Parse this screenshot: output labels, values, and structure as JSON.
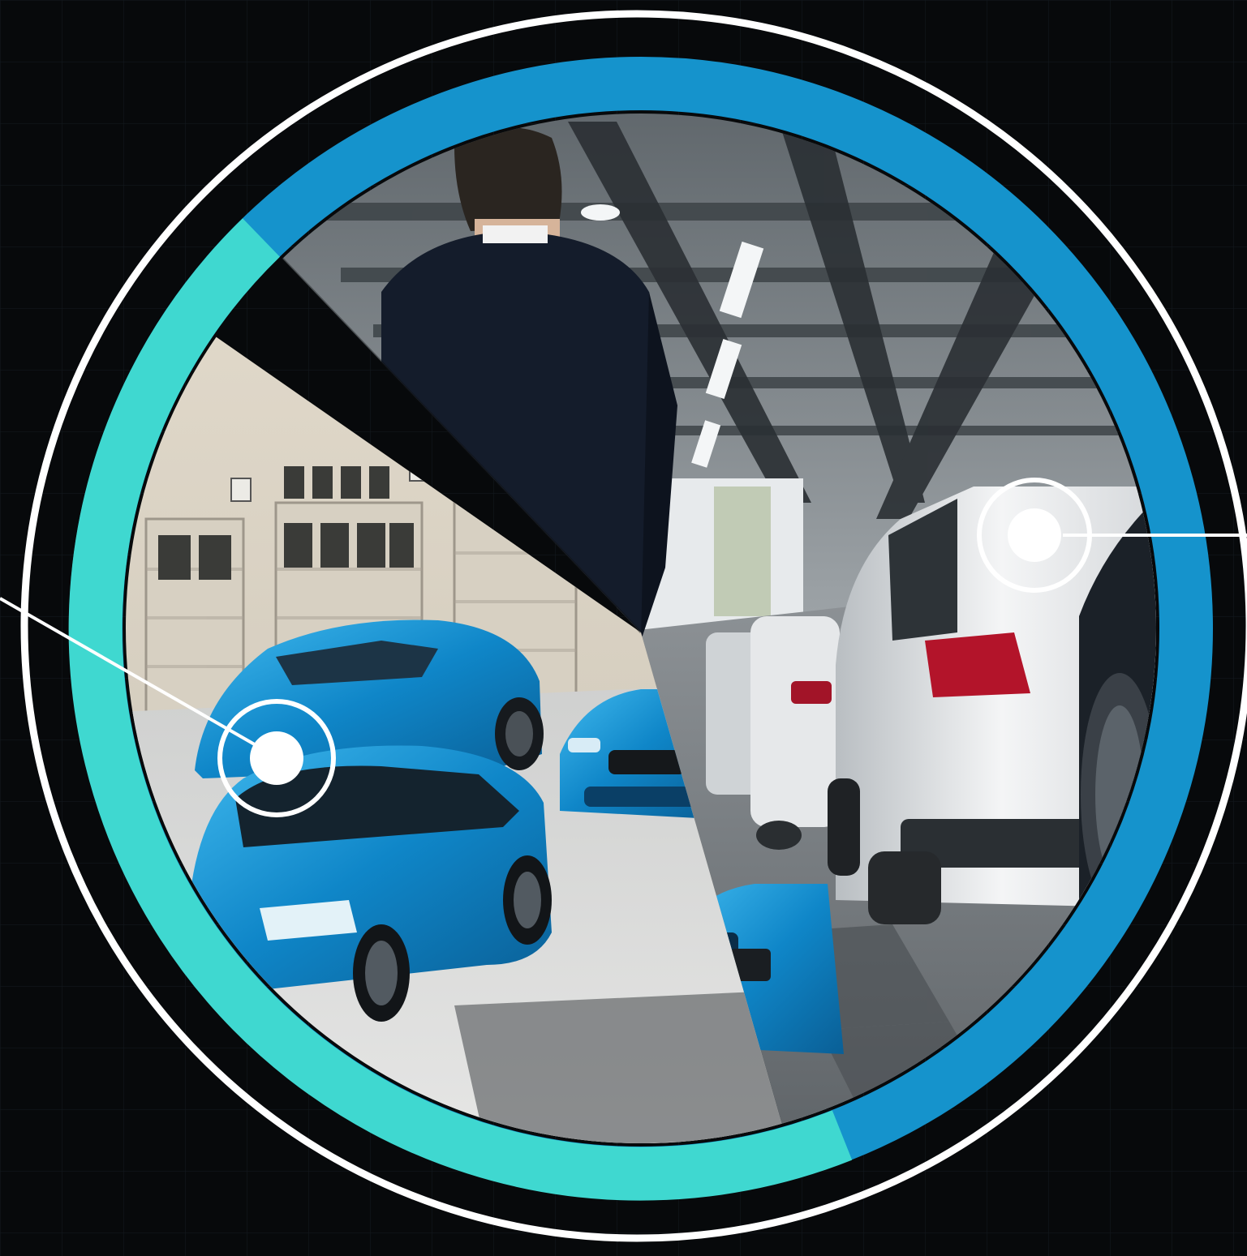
{
  "scene": {
    "description_tag": "garage-split-circle-graphic",
    "colors": {
      "background": "#07090b",
      "grid": "#14191d",
      "outer_ring": "#ffffff",
      "arc_cyan": "#3fd8d0",
      "arc_blue": "#1593cc",
      "car_blue": "#0e7fc2",
      "car_blue_light": "#39b1e8",
      "car_white": "#e9ecef",
      "tail_light": "#b3142a",
      "suit": "#141c2b",
      "hotspot": "#ffffff"
    },
    "icons": [
      "hotspot-marker-icon",
      "hotspot-marker-icon"
    ]
  }
}
